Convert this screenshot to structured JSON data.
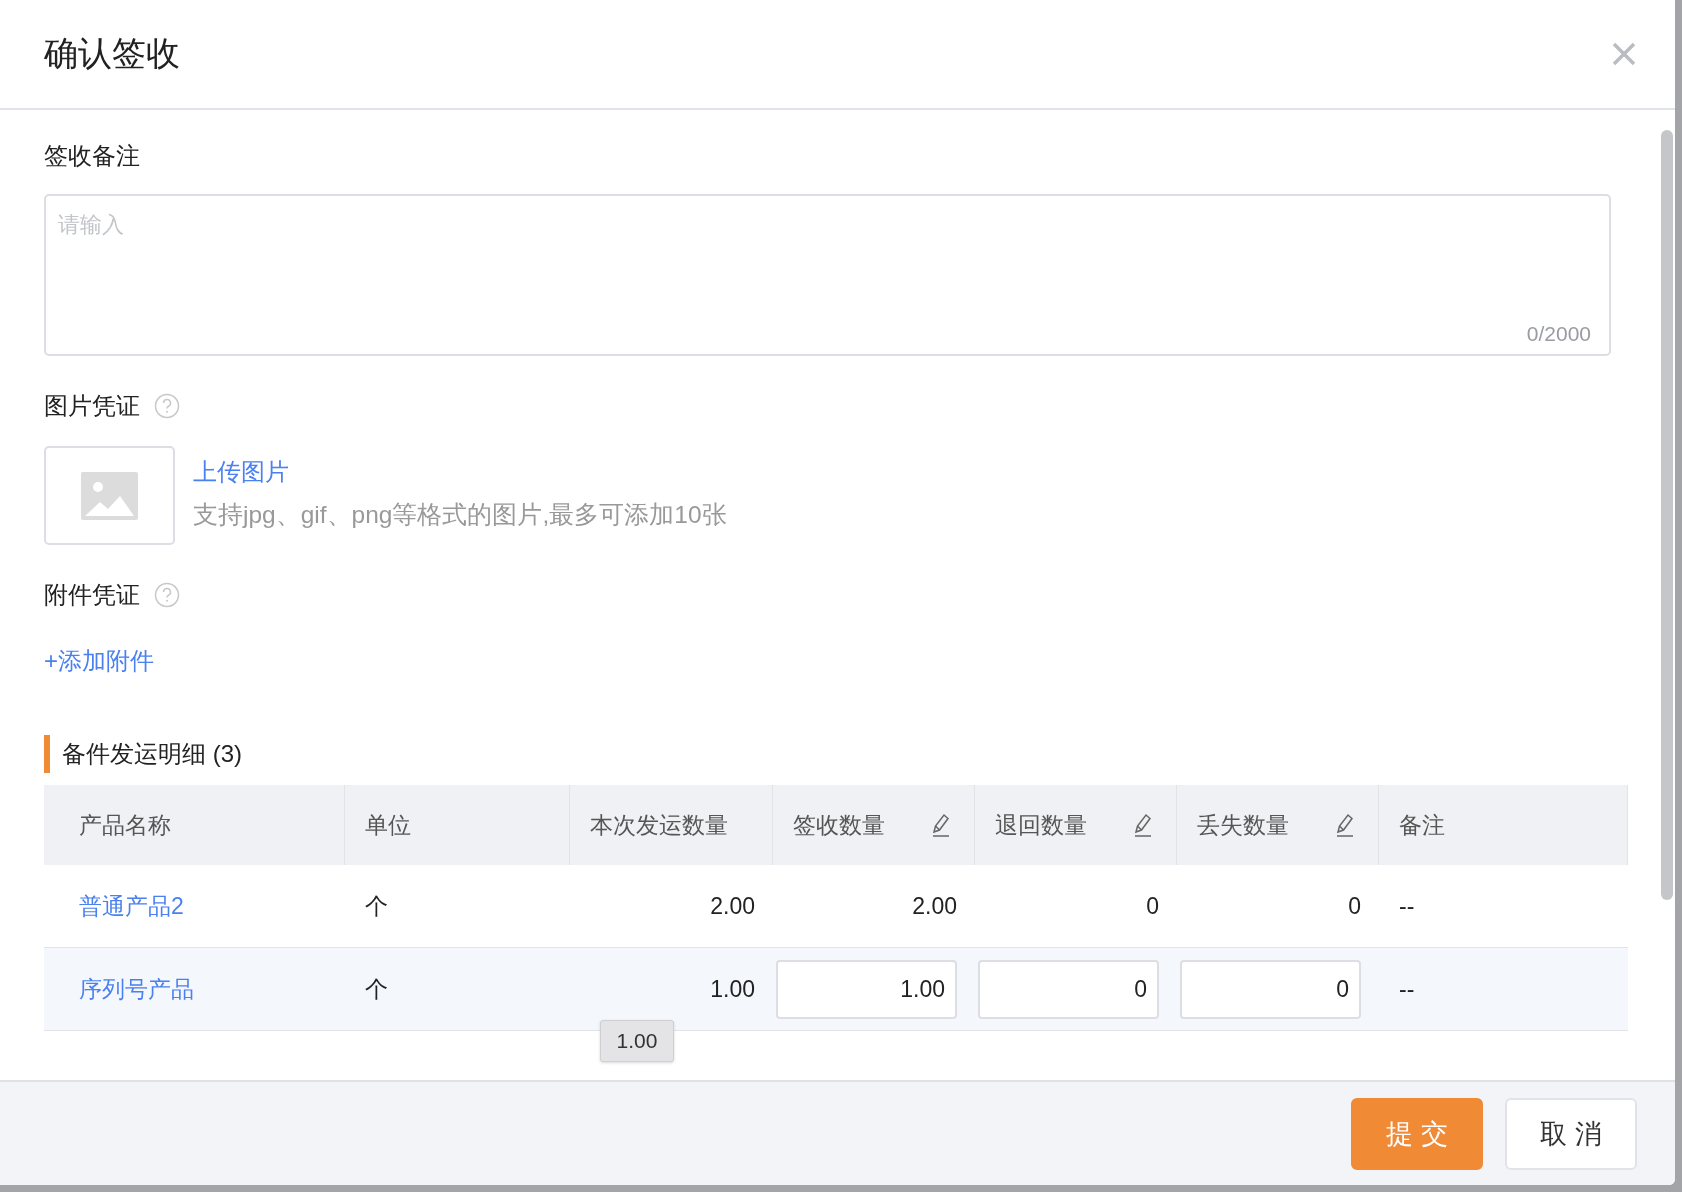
{
  "dialog": {
    "title": "确认签收"
  },
  "remark": {
    "label": "签收备注",
    "placeholder": "请输入",
    "counter": "0/2000"
  },
  "images": {
    "label": "图片凭证",
    "upload_link": "上传图片",
    "hint": "支持jpg、gif、png等格式的图片,最多可添加10张"
  },
  "attachments": {
    "label": "附件凭证",
    "add_link": "+添加附件"
  },
  "section": {
    "title": "备件发运明细 (3)"
  },
  "table": {
    "columns": [
      {
        "label": "产品名称",
        "editable": false
      },
      {
        "label": "单位",
        "editable": false
      },
      {
        "label": "本次发运数量",
        "editable": false
      },
      {
        "label": "签收数量",
        "editable": true
      },
      {
        "label": "退回数量",
        "editable": true
      },
      {
        "label": "丢失数量",
        "editable": true
      },
      {
        "label": "备注",
        "editable": false
      }
    ],
    "rows": [
      {
        "kind": "text",
        "name": "普通产品2",
        "unit": "个",
        "shipped": "2.00",
        "received": "2.00",
        "returned": "0",
        "lost": "0",
        "note": "--"
      },
      {
        "kind": "input",
        "name": "序列号产品",
        "unit": "个",
        "shipped": "1.00",
        "received": "1.00",
        "returned": "0",
        "lost": "0",
        "note": "--"
      }
    ]
  },
  "tooltip": {
    "text": "1.00"
  },
  "buttons": [
    {
      "label": "提 交",
      "kind": "primary"
    },
    {
      "label": "取 消",
      "kind": "default"
    }
  ]
}
